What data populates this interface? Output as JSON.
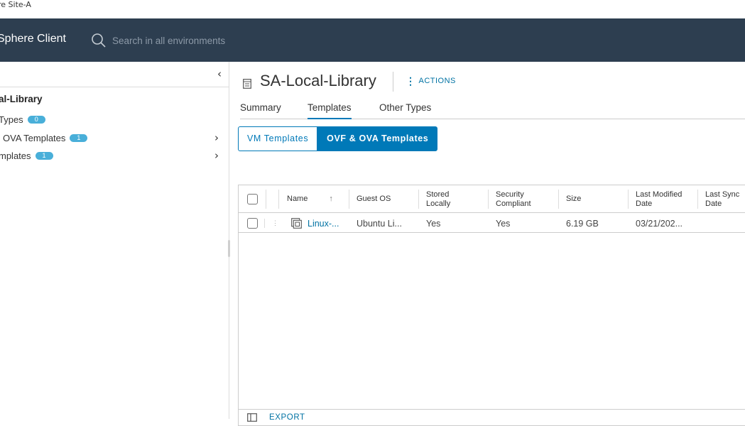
{
  "window": {
    "title": "re Site-A"
  },
  "header": {
    "brand": "Sphere Client",
    "search_placeholder": "Search in all environments",
    "bg_color": "#2d3e50"
  },
  "sidebar": {
    "title": "al-Library",
    "items": [
      {
        "label": "Types",
        "badge": "0",
        "has_chevron": false
      },
      {
        "label": "OVA Templates",
        "badge": "1",
        "has_chevron": true
      },
      {
        "label": "mplates",
        "badge": "1",
        "has_chevron": true
      }
    ]
  },
  "main": {
    "title": "SA-Local-Library",
    "actions_label": "ACTIONS",
    "tabs": [
      {
        "label": "Summary",
        "active": false
      },
      {
        "label": "Templates",
        "active": true
      },
      {
        "label": "Other Types",
        "active": false
      }
    ],
    "segments": [
      {
        "label": "VM Templates",
        "selected": false
      },
      {
        "label": "OVF & OVA Templates",
        "selected": true
      }
    ],
    "grid": {
      "columns": [
        "Name",
        "Guest OS",
        "Stored Locally",
        "Security Compliant",
        "Size",
        "Last Modified Date",
        "Last Sync Date"
      ],
      "sort_indicator": "↑",
      "rows": [
        {
          "name": "Linux-...",
          "guest_os": "Ubuntu Li...",
          "stored_locally": "Yes",
          "security_compliant": "Yes",
          "size": "6.19 GB",
          "last_modified": "03/21/202...",
          "last_sync": ""
        }
      ],
      "export_label": "EXPORT"
    }
  },
  "colors": {
    "accent": "#0079b8",
    "link": "#0072a3",
    "badge": "#49afd9"
  }
}
